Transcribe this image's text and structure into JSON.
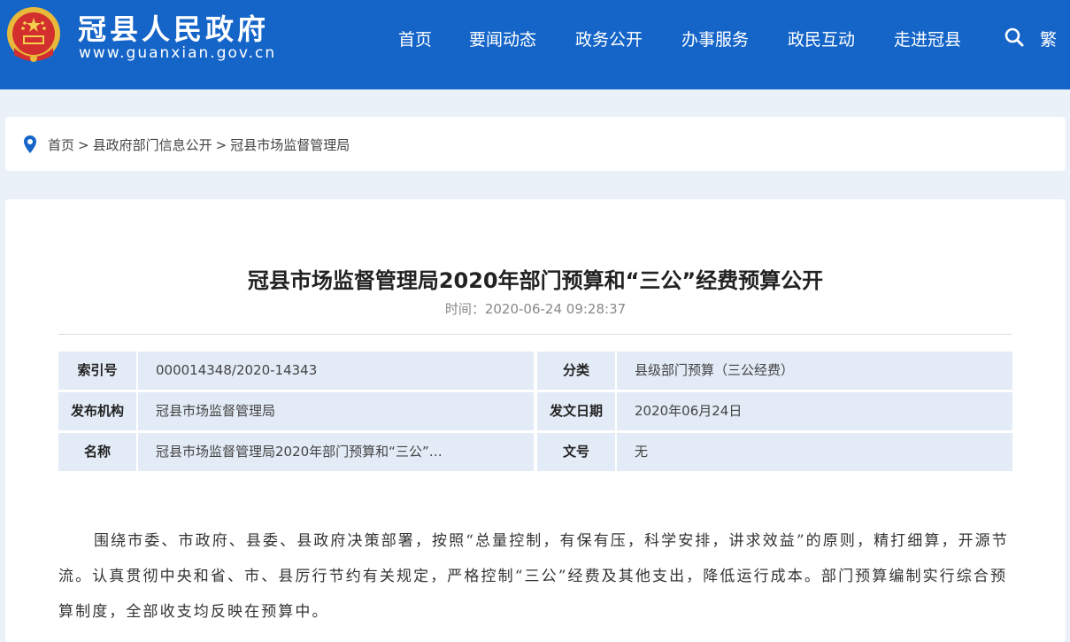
{
  "header": {
    "site_name": "冠县人民政府",
    "site_url": "www.guanxian.gov.cn",
    "nav": [
      "首页",
      "要闻动态",
      "政务公开",
      "办事服务",
      "政民互动",
      "走进冠县"
    ],
    "search_icon": "search-icon",
    "traditional_label": "繁",
    "brand_color": "#1565c9"
  },
  "breadcrumb": {
    "icon": "location-pin-icon",
    "items": [
      "首页",
      "县政府部门信息公开",
      "冠县市场监督管理局"
    ],
    "separator": ">"
  },
  "article": {
    "title": "冠县市场监督管理局2020年部门预算和“三公”经费预算公开",
    "time_label": "时间：",
    "time_value": "2020-06-24 09:28:37",
    "meta": [
      {
        "label": "索引号",
        "value": "000014348/2020-14343",
        "label2": "分类",
        "value2": "县级部门预算（三公经费）"
      },
      {
        "label": "发布机构",
        "value": "冠县市场监督管理局",
        "label2": "发文日期",
        "value2": "2020年06月24日"
      },
      {
        "label": "名称",
        "value": "冠县市场监督管理局2020年部门预算和“三公”…",
        "label2": "文号",
        "value2": "无"
      }
    ],
    "body": "围绕市委、市政府、县委、县政府决策部署，按照“总量控制，有保有压，科学安排，讲求效益”的原则，精打细算，开源节流。认真贯彻中央和省、市、县厉行节约有关规定，严格控制“三公”经费及其他支出，降低运行成本。部门预算编制实行综合预算制度，全部收支均反映在预算中。"
  }
}
